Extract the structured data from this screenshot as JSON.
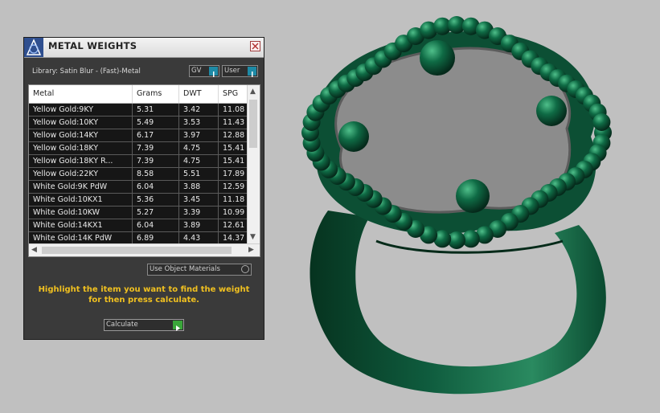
{
  "panel": {
    "title": "METAL WEIGHTS",
    "library_label": "Library: Satin Blur - (Fast)-Metal",
    "gv_label": "GV",
    "user_label": "User",
    "use_object_label": "Use Object Materials",
    "instruction": "Highlight the item you want to find the weight for then press calculate.",
    "calculate_label": "Calculate"
  },
  "table": {
    "columns": [
      "Metal",
      "Grams",
      "DWT",
      "SPG"
    ],
    "rows": [
      [
        "Yellow Gold:9KY",
        "5.31",
        "3.42",
        "11.08"
      ],
      [
        "Yellow Gold:10KY",
        "5.49",
        "3.53",
        "11.43"
      ],
      [
        "Yellow Gold:14KY",
        "6.17",
        "3.97",
        "12.88"
      ],
      [
        "Yellow Gold:18KY",
        "7.39",
        "4.75",
        "15.41"
      ],
      [
        "Yellow Gold:18KY R...",
        "7.39",
        "4.75",
        "15.41"
      ],
      [
        "Yellow Gold:22KY",
        "8.58",
        "5.51",
        "17.89"
      ],
      [
        "White Gold:9K PdW",
        "6.04",
        "3.88",
        "12.59"
      ],
      [
        "White Gold:10KX1",
        "5.36",
        "3.45",
        "11.18"
      ],
      [
        "White Gold:10KW",
        "5.27",
        "3.39",
        "10.99"
      ],
      [
        "White Gold:14KX1",
        "6.04",
        "3.89",
        "12.61"
      ],
      [
        "White Gold:14K PdW",
        "6.89",
        "4.43",
        "14.37"
      ]
    ]
  },
  "icons": {
    "app": "app-logo-icon",
    "close": "close-icon",
    "dropdown": "dropdown-arrow-icon",
    "go": "play-arrow-icon"
  },
  "colors": {
    "ring": "#0f5c3e",
    "instruction": "#f0c020",
    "panel_bg": "#3a3a3a"
  }
}
